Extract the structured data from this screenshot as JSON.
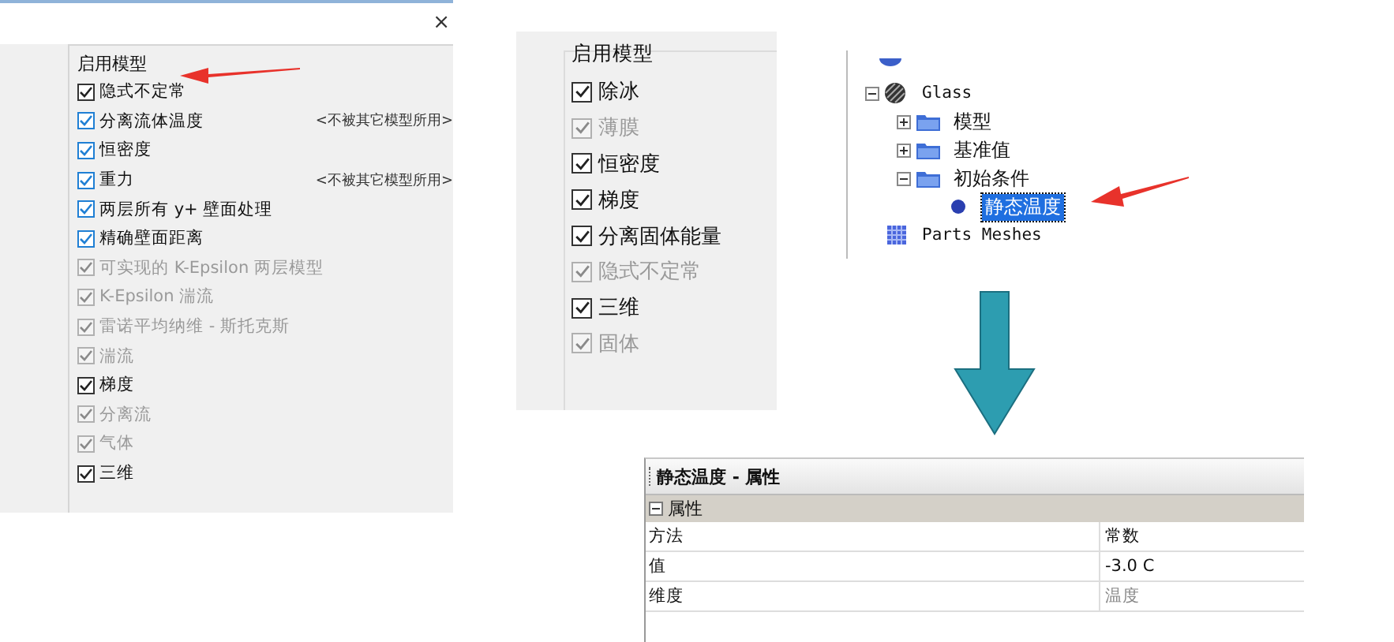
{
  "models_dialog": {
    "close": "×",
    "group_title": "启用模型",
    "items": [
      {
        "label": "隐式不定常",
        "checked": true,
        "disabled": false,
        "kind": "plain"
      },
      {
        "label": "分离流体温度",
        "checked": true,
        "disabled": false,
        "kind": "accent",
        "note": "<不被其它模型所用>"
      },
      {
        "label": "恒密度",
        "checked": true,
        "disabled": false,
        "kind": "accent"
      },
      {
        "label": "重力",
        "checked": true,
        "disabled": false,
        "kind": "accent",
        "note": "<不被其它模型所用>"
      },
      {
        "label": "两层所有 y+ 壁面处理",
        "checked": true,
        "disabled": false,
        "kind": "accent"
      },
      {
        "label": "精确壁面距离",
        "checked": true,
        "disabled": false,
        "kind": "accent"
      },
      {
        "label": "可实现的 K-Epsilon 两层模型",
        "checked": true,
        "disabled": true,
        "kind": "plain"
      },
      {
        "label": "K-Epsilon 湍流",
        "checked": true,
        "disabled": true,
        "kind": "plain"
      },
      {
        "label": "雷诺平均纳维 - 斯托克斯",
        "checked": true,
        "disabled": true,
        "kind": "plain"
      },
      {
        "label": "湍流",
        "checked": true,
        "disabled": true,
        "kind": "plain"
      },
      {
        "label": "梯度",
        "checked": true,
        "disabled": false,
        "kind": "plain"
      },
      {
        "label": "分离流",
        "checked": true,
        "disabled": true,
        "kind": "plain"
      },
      {
        "label": "气体",
        "checked": true,
        "disabled": true,
        "kind": "plain"
      },
      {
        "label": "三维",
        "checked": true,
        "disabled": false,
        "kind": "plain"
      }
    ]
  },
  "models_panel": {
    "group_title": "启用模型",
    "items": [
      {
        "label": "除冰",
        "checked": true,
        "disabled": false
      },
      {
        "label": "薄膜",
        "checked": true,
        "disabled": true
      },
      {
        "label": "恒密度",
        "checked": true,
        "disabled": false
      },
      {
        "label": "梯度",
        "checked": true,
        "disabled": false
      },
      {
        "label": "分离固体能量",
        "checked": true,
        "disabled": false
      },
      {
        "label": "隐式不定常",
        "checked": true,
        "disabled": true
      },
      {
        "label": "三维",
        "checked": true,
        "disabled": false
      },
      {
        "label": "固体",
        "checked": true,
        "disabled": true
      }
    ]
  },
  "tree": {
    "items": [
      {
        "label": "Glass",
        "kind": "region",
        "expanded": true,
        "selected": false,
        "children": [
          {
            "label": "模型",
            "kind": "folder",
            "expanded": false,
            "selected": false
          },
          {
            "label": "基准值",
            "kind": "folder",
            "expanded": false,
            "selected": false
          },
          {
            "label": "初始条件",
            "kind": "folder",
            "expanded": true,
            "selected": false,
            "children": [
              {
                "label": "静态温度",
                "kind": "value",
                "selected": true
              }
            ]
          }
        ]
      },
      {
        "label": "Parts Meshes",
        "kind": "mesh",
        "selected": false
      }
    ]
  },
  "properties": {
    "title": "静态温度 - 属性",
    "section": "属性",
    "section_expanded": true,
    "rows": [
      {
        "name": "方法",
        "value": "常数",
        "readonly": false
      },
      {
        "name": "值",
        "value": "-3.0 C",
        "readonly": false
      },
      {
        "name": "维度",
        "value": "温度",
        "readonly": true
      }
    ]
  }
}
